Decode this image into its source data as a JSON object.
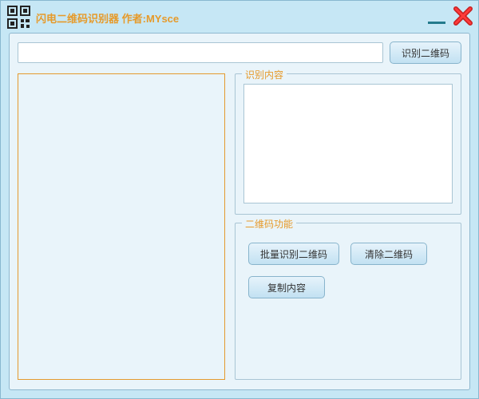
{
  "title": "闪电二维码识别器  作者:MYsce",
  "icons": {
    "app": "qr-icon",
    "minimize": "minimize-icon",
    "close": "close-icon"
  },
  "topRow": {
    "pathValue": "",
    "recognizeBtn": "识别二维码"
  },
  "groups": {
    "result": {
      "legend": "识别内容",
      "text": ""
    },
    "func": {
      "legend": "二维码功能",
      "batchBtn": "批量识别二维码",
      "clearBtn": "清除二维码",
      "copyBtn": "复制内容"
    }
  }
}
